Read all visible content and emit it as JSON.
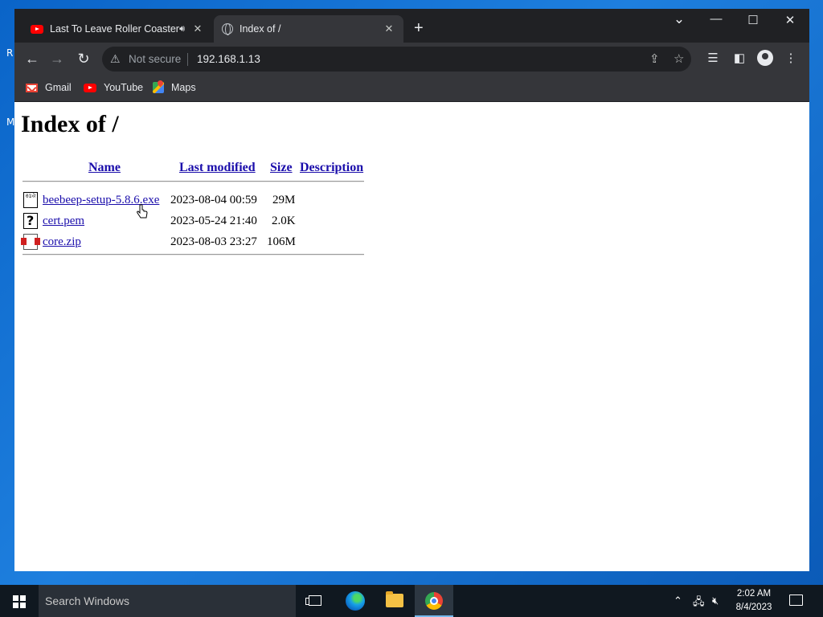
{
  "browser": {
    "tabs": [
      {
        "title": "Last To Leave Roller Coaster V",
        "icon": "youtube-icon",
        "audio_icon": "speaker-icon",
        "active": false
      },
      {
        "title": "Index of /",
        "icon": "globe-icon",
        "active": true
      }
    ],
    "new_tab_glyph": "+",
    "window_controls": {
      "tab_search": "⌄",
      "minimize": "—",
      "maximize": "☐",
      "close": "✕"
    },
    "toolbar": {
      "back": "←",
      "forward": "→",
      "reload": "↻",
      "security_label": "Not secure",
      "url": "192.168.1.13"
    },
    "bookmarks": [
      {
        "label": "Gmail",
        "icon": "gmail-icon"
      },
      {
        "label": "YouTube",
        "icon": "youtube-icon"
      },
      {
        "label": "Maps",
        "icon": "maps-icon"
      }
    ]
  },
  "page": {
    "heading": "Index of /",
    "columns": {
      "name": "Name",
      "modified": "Last modified",
      "size": "Size",
      "description": "Description"
    },
    "files": [
      {
        "name": "beebeep-setup-5.8.6.exe",
        "modified": "2023-08-04 00:59",
        "size": "29M",
        "icon": "binary-file-icon"
      },
      {
        "name": "cert.pem",
        "modified": "2023-05-24 21:40",
        "size": "2.0K",
        "icon": "unknown-file-icon"
      },
      {
        "name": "core.zip",
        "modified": "2023-08-03 23:27",
        "size": "106M",
        "icon": "compressed-file-icon"
      }
    ]
  },
  "desktop": {
    "fragments": [
      "R",
      "M"
    ]
  },
  "taskbar": {
    "search_placeholder": "Search Windows",
    "pinned": [
      "task-view-icon",
      "edge-icon",
      "file-explorer-icon",
      "chrome-icon"
    ],
    "clock": {
      "time": "2:02 AM",
      "date": "8/4/2023"
    }
  },
  "colors": {
    "link": "#1a0dab",
    "chrome_dark": "#202124",
    "toolbar": "#35363a",
    "taskbar": "#101820"
  }
}
